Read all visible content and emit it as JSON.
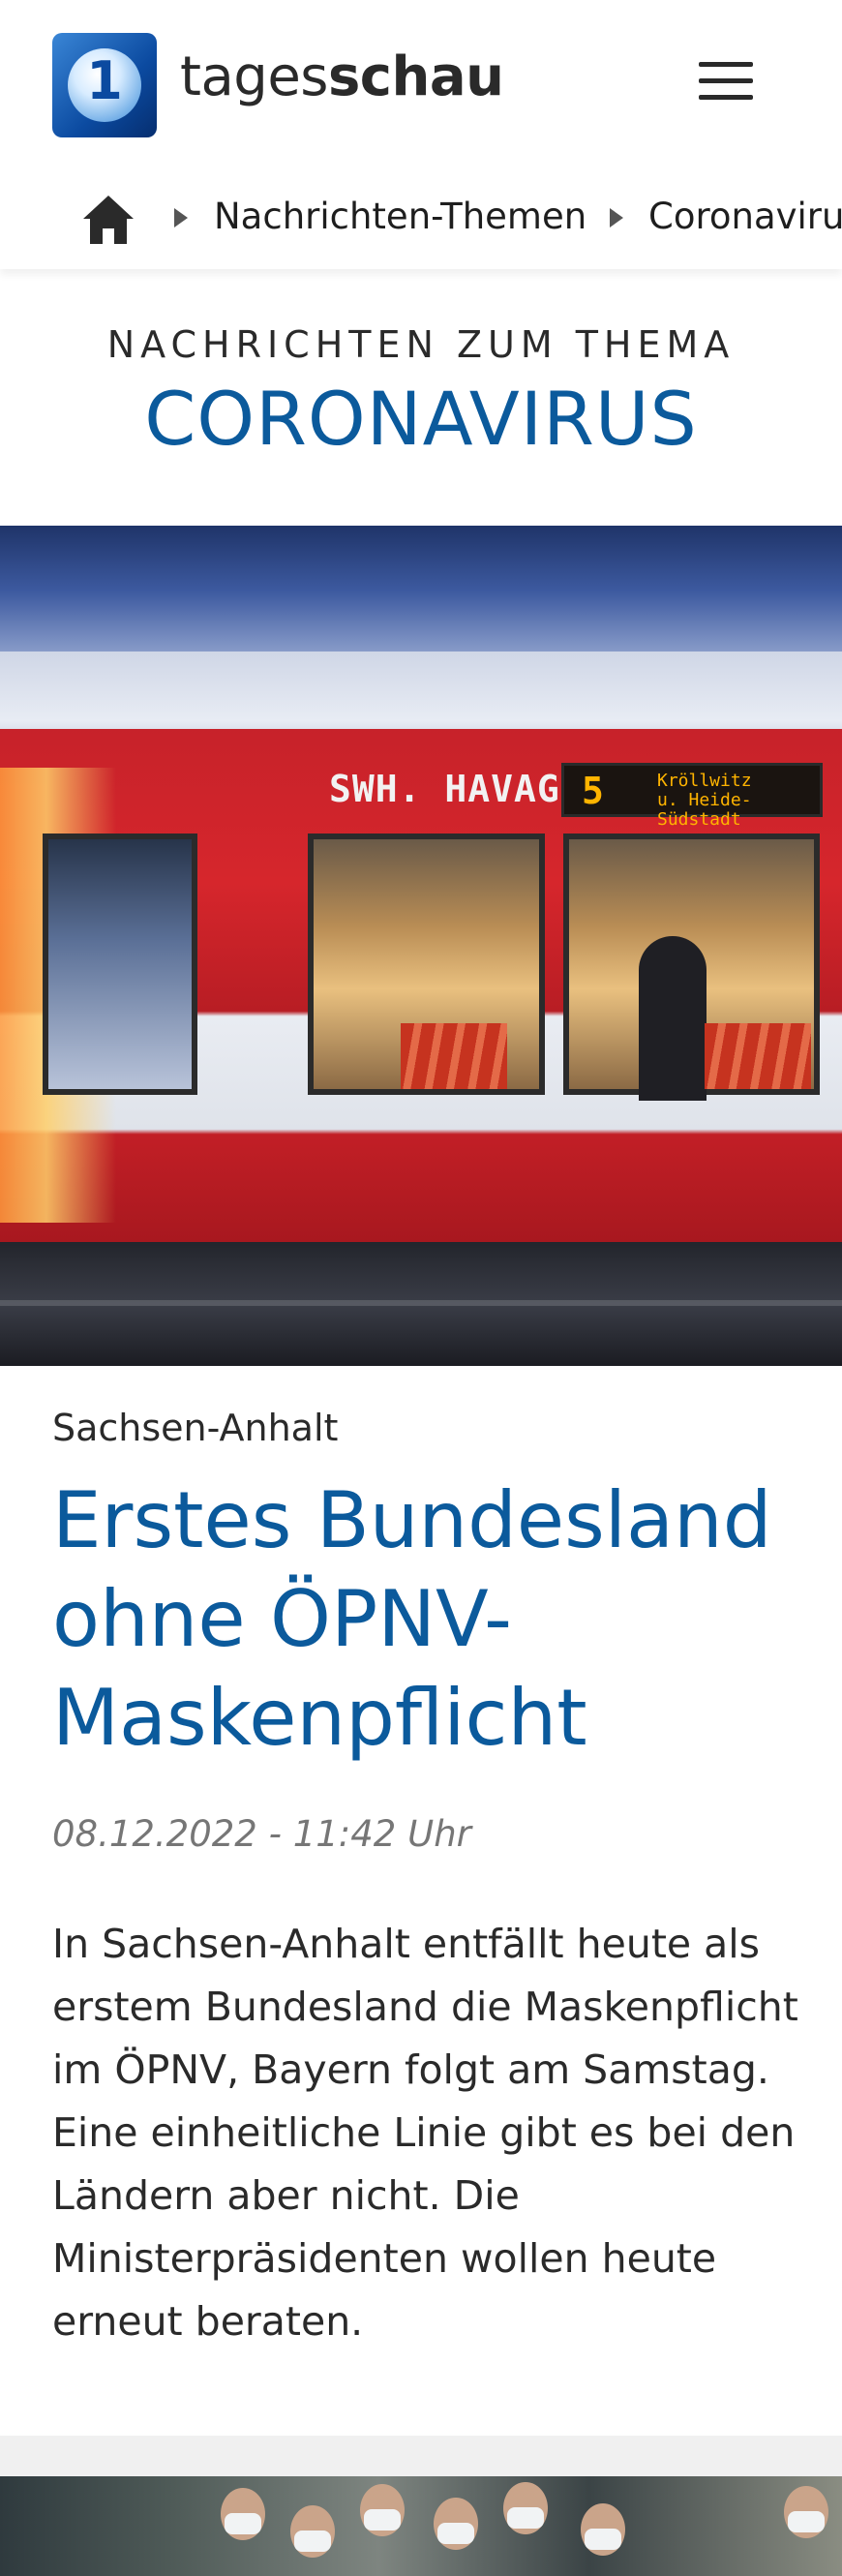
{
  "header": {
    "logo_label": "tagesschau logo",
    "brand_regular": "tages",
    "brand_bold": "schau",
    "menu_icon": "hamburger-menu-icon"
  },
  "breadcrumb": {
    "home_icon": "home-icon",
    "items": [
      {
        "label": "Nachrichten-Themen"
      },
      {
        "label": "Coronavirus"
      }
    ]
  },
  "topic": {
    "kicker": "NACHRICHTEN ZUM THEMA",
    "title": "CORONAVIRUS"
  },
  "teaser": {
    "image": {
      "tram_sign": "SWH. HAVAG",
      "line_number": "5",
      "destination_line1": "Kröllwitz",
      "destination_line2": "u. Heide-Südstadt"
    },
    "roof_line": "Sachsen-Anhalt",
    "headline": "Erstes Bundesland ohne ÖPNV-Maskenpflicht",
    "date": "08.12.2022 - 11:42 Uhr",
    "text": "In Sachsen-Anhalt entfällt heute als erstem Bundesland die Maskenpflicht im ÖPNV, Bayern folgt am Samstag. Eine einheitliche Linie gibt es bei den Ländern aber nicht. Die Ministerpräsidenten wollen heute erneut beraten."
  },
  "colors": {
    "accent_blue": "#0b5a9c",
    "text_dark": "#2a2a2a",
    "date_grey": "#767676",
    "divider_grey": "#f0f0f0"
  }
}
